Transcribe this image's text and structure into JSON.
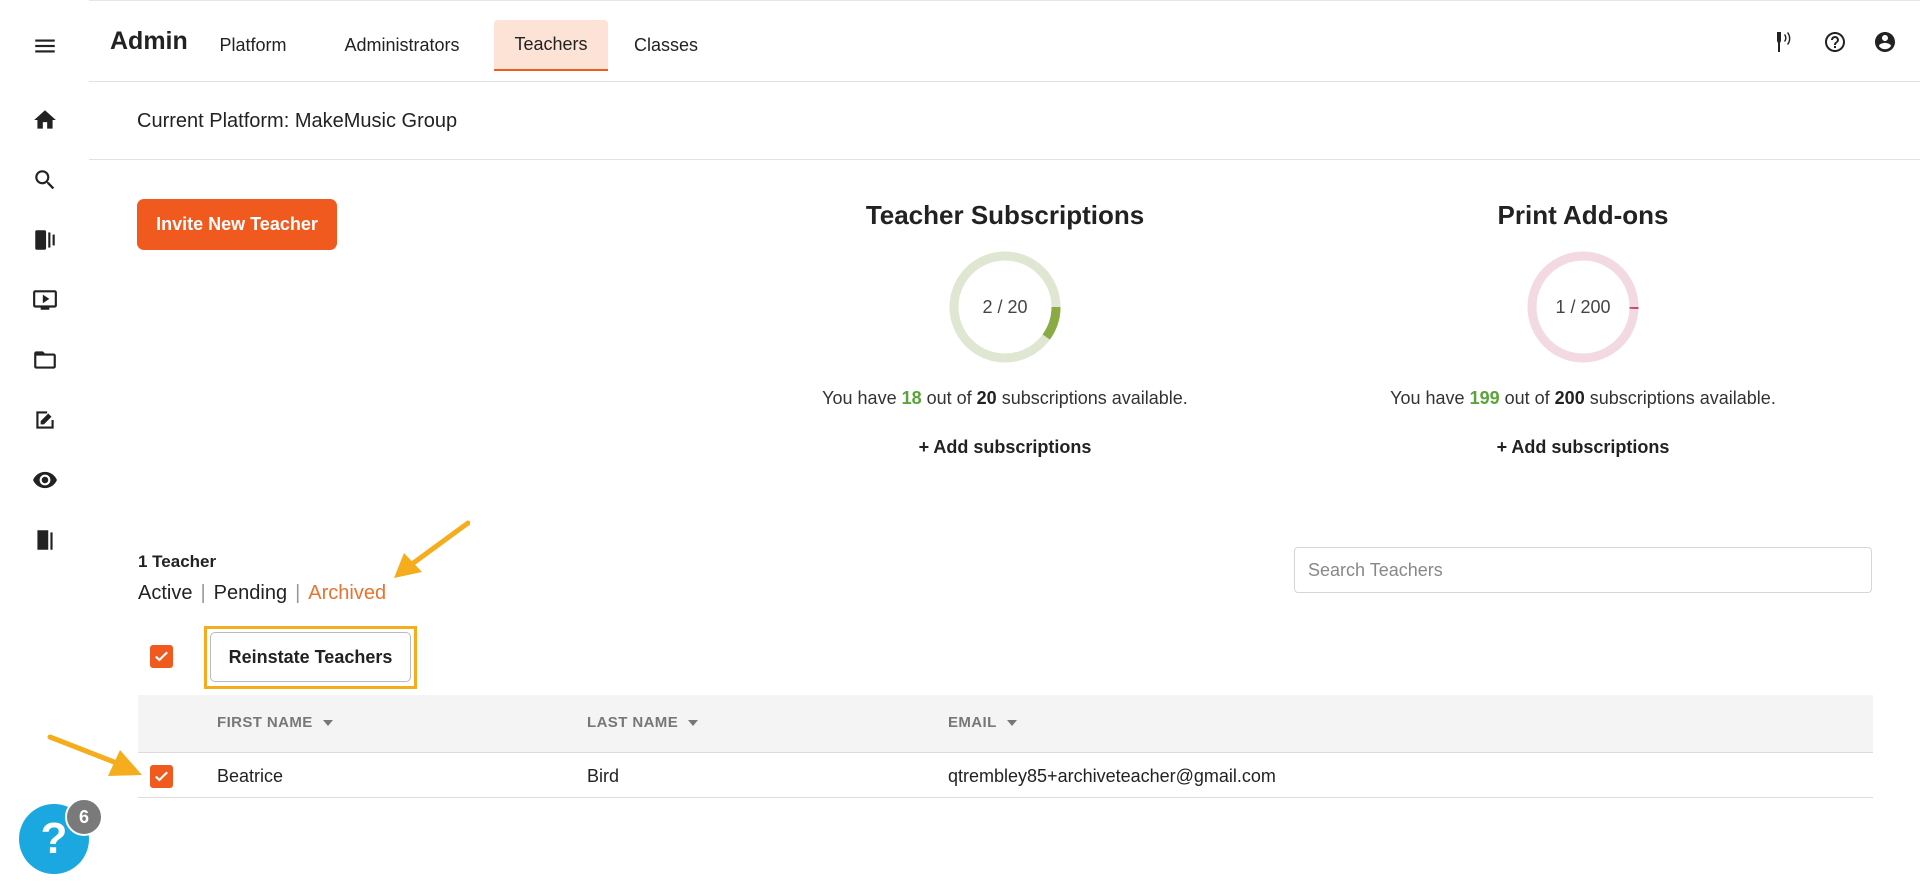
{
  "header": {
    "brand": "Admin",
    "tabs": [
      {
        "label": "Platform",
        "active": false
      },
      {
        "label": "Administrators",
        "active": false
      },
      {
        "label": "Teachers",
        "active": true
      },
      {
        "label": "Classes",
        "active": false
      }
    ],
    "icons": [
      "tuner-icon",
      "help-circle-icon",
      "account-circle-icon"
    ]
  },
  "sidebar": {
    "items": [
      "menu-icon",
      "home-icon",
      "search-icon",
      "library-icon",
      "video-icon",
      "folder-icon",
      "assignment-icon",
      "eye-icon",
      "exit-door-icon"
    ]
  },
  "platform": {
    "label": "Current Platform: MakeMusic Group"
  },
  "actions": {
    "invite_label": "Invite New Teacher",
    "reinstate_label": "Reinstate Teachers"
  },
  "subscriptions": [
    {
      "title": "Teacher Subscriptions",
      "used": 2,
      "total": 20,
      "donut_label": "2 / 20",
      "text_prefix": "You have ",
      "available": "18",
      "text_mid": " out of ",
      "total_text": "20",
      "text_suffix": " subscriptions available.",
      "add_label": "+ Add subscriptions",
      "track_color": "#dfe6d1",
      "fill_color": "#8aaa45"
    },
    {
      "title": "Print Add-ons",
      "used": 1,
      "total": 200,
      "donut_label": "1 / 200",
      "text_prefix": "You have ",
      "available": "199",
      "text_mid": " out of ",
      "total_text": "200",
      "text_suffix": " subscriptions available.",
      "add_label": "+ Add subscriptions",
      "track_color": "#f3d9e2",
      "fill_color": "#c94a72"
    }
  ],
  "teachers": {
    "count_label": "1 Teacher",
    "filters": [
      {
        "label": "Active",
        "active": false
      },
      {
        "label": "Pending",
        "active": false
      },
      {
        "label": "Archived",
        "active": true
      }
    ],
    "search_placeholder": "Search Teachers",
    "columns": [
      "FIRST NAME",
      "LAST NAME",
      "EMAIL"
    ],
    "rows": [
      {
        "first": "Beatrice",
        "last": "Bird",
        "email": "qtrembley85+archiveteacher@gmail.com",
        "checked": true
      }
    ],
    "select_all_checked": true
  },
  "help": {
    "glyph": "?",
    "badge": "6"
  },
  "colors": {
    "accent": "#f15a1f",
    "highlight": "#f5ac1d",
    "help": "#1ba7e0"
  }
}
